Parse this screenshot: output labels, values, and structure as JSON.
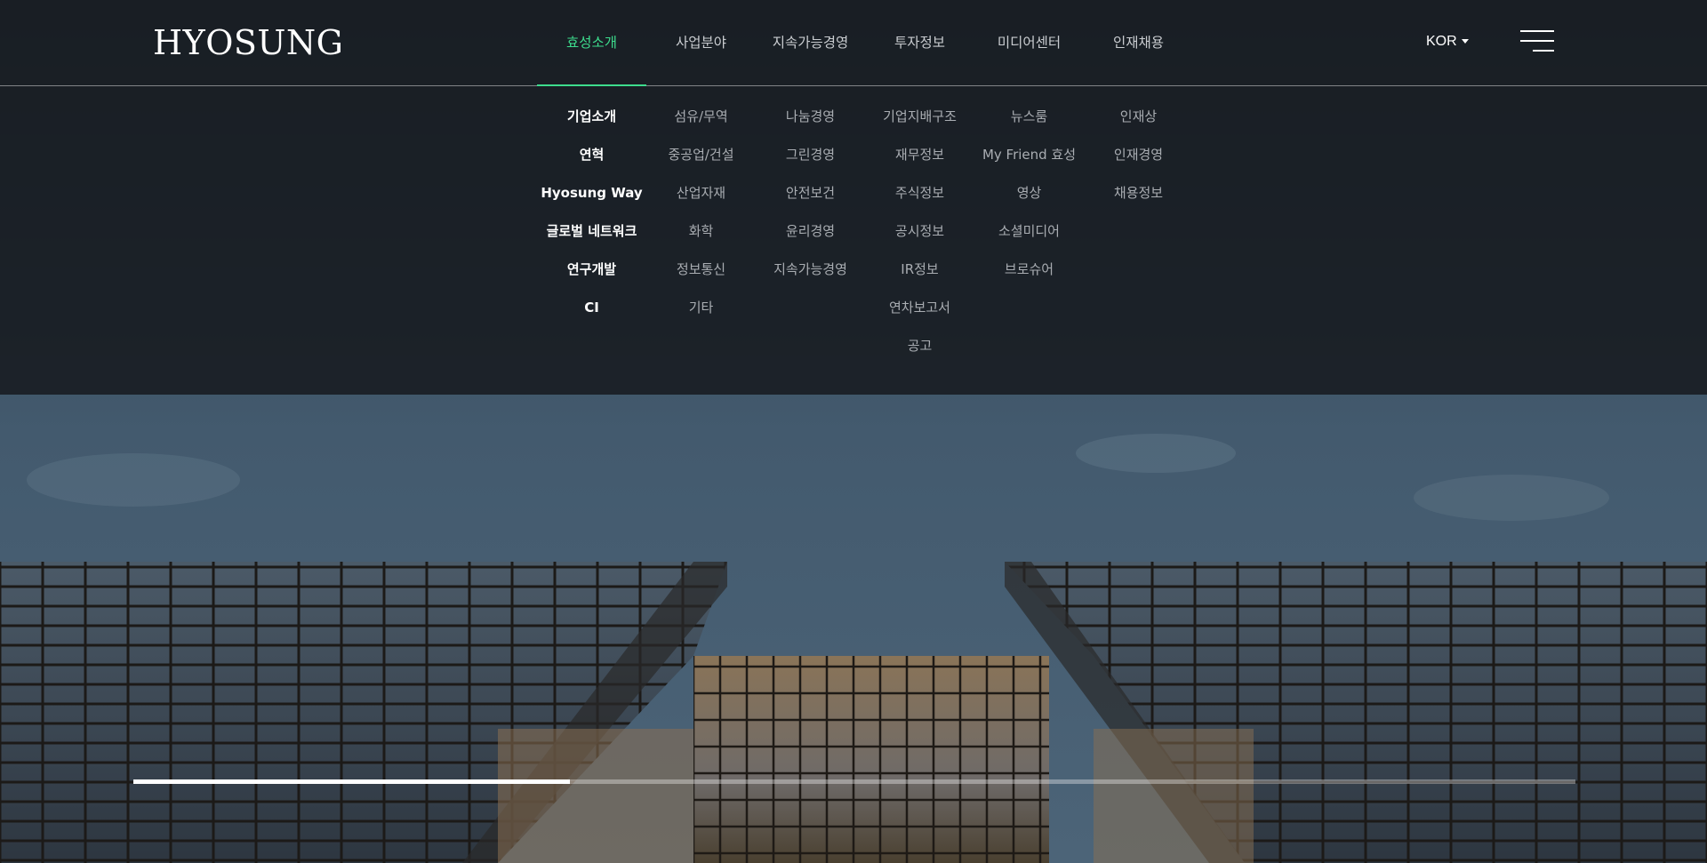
{
  "brand": {
    "logo_text": "HYOSUNG"
  },
  "nav": {
    "items": [
      {
        "label": "효성소개",
        "active": true
      },
      {
        "label": "사업분야",
        "active": false
      },
      {
        "label": "지속가능경영",
        "active": false
      },
      {
        "label": "투자정보",
        "active": false
      },
      {
        "label": "미디어센터",
        "active": false
      },
      {
        "label": "인재채용",
        "active": false
      }
    ],
    "language": "KOR"
  },
  "submenu": {
    "columns": [
      [
        "기업소개",
        "연혁",
        "Hyosung Way",
        "글로벌 네트워크",
        "연구개발",
        "CI"
      ],
      [
        "섬유/무역",
        "중공업/건설",
        "산업자재",
        "화학",
        "정보통신",
        "기타"
      ],
      [
        "나눔경영",
        "그린경영",
        "안전보건",
        "윤리경영",
        "지속가능경영"
      ],
      [
        "기업지배구조",
        "재무정보",
        "주식정보",
        "공시정보",
        "IR정보",
        "연차보고서",
        "공고"
      ],
      [
        "뉴스룸",
        "My Friend 효성",
        "영상",
        "소셜미디어",
        "브로슈어"
      ],
      [
        "인재상",
        "인재경영",
        "채용정보"
      ]
    ]
  },
  "slider": {
    "progress": 0.303
  },
  "colors": {
    "accent": "#3ddc8d",
    "overlay": "#161a1e",
    "sky": "#3e5366"
  },
  "icons": {
    "menu": "hamburger-icon",
    "language_caret": "caret-down-icon"
  }
}
